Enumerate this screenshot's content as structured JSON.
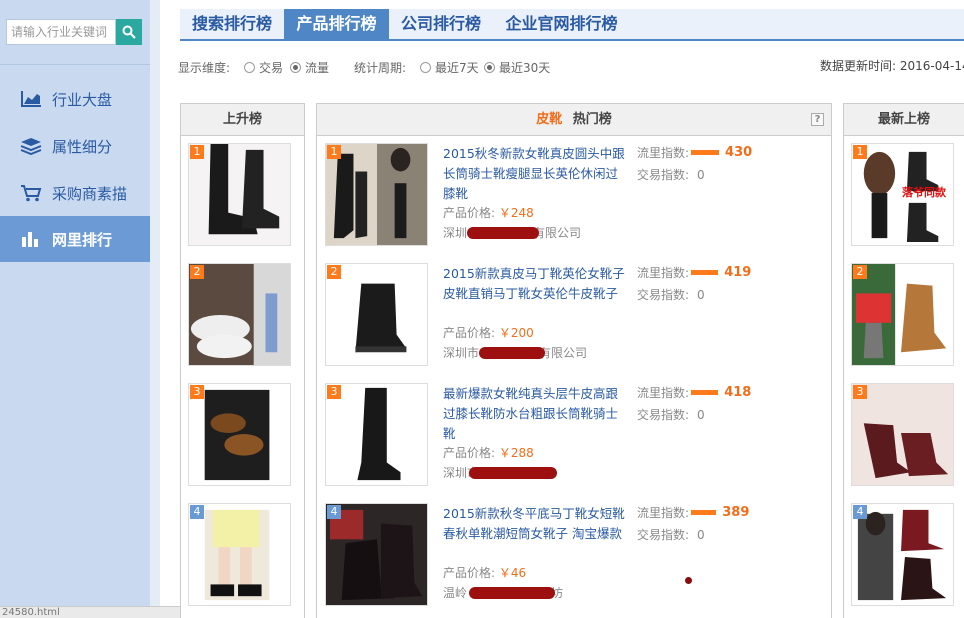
{
  "sidebar": {
    "search_placeholder": "请输入行业关键词",
    "items": [
      {
        "label": "行业大盘",
        "icon": "area-chart-icon"
      },
      {
        "label": "属性细分",
        "icon": "layers-icon"
      },
      {
        "label": "采购商素描",
        "icon": "cart-icon"
      },
      {
        "label": "网里排行",
        "icon": "bar-chart-icon",
        "active": true
      }
    ]
  },
  "status_bar": "24580.html",
  "tabs": [
    {
      "label": "搜索排行榜",
      "active": false
    },
    {
      "label": "产品排行榜",
      "active": true
    },
    {
      "label": "公司排行榜",
      "active": false
    },
    {
      "label": "企业官网排行榜",
      "active": false
    }
  ],
  "filters": {
    "dimension_label": "显示维度:",
    "dimension_options": [
      {
        "label": "交易",
        "checked": false
      },
      {
        "label": "流量",
        "checked": true
      }
    ],
    "period_label": "统计周期:",
    "period_options": [
      {
        "label": "最近7天",
        "checked": false
      },
      {
        "label": "最近30天",
        "checked": true
      }
    ],
    "update_text": "数据更新时间: 2016-04-14"
  },
  "rising": {
    "title": "上升榜",
    "ranks": [
      "1",
      "2",
      "3",
      "4"
    ]
  },
  "hot": {
    "category": "皮靴",
    "title": "热门榜",
    "help": "?",
    "flow_label": "流里指数:",
    "trade_label": "交易指数:",
    "price_label": "产品价格:",
    "products": [
      {
        "rank": "1",
        "title": "2015秋冬新款女靴真皮圆头中跟长筒骑士靴瘦腿显长英伦休闲过膝靴",
        "price": "￥248",
        "shop_prefix": "深圳",
        "shop_suffix": "有限公司",
        "flow": "430",
        "trade": "0",
        "bar_pct": 100
      },
      {
        "rank": "2",
        "title": "2015新款真皮马丁靴英伦女靴子皮靴直销马丁靴女英伦牛皮靴子",
        "price": "￥200",
        "shop_prefix": "深圳市",
        "shop_suffix": "有限公司",
        "flow": "419",
        "trade": "0",
        "bar_pct": 97
      },
      {
        "rank": "3",
        "title": "最新爆款女靴纯真头层牛皮高跟过膝长靴防水台粗跟长筒靴骑士靴",
        "price": "￥288",
        "shop_prefix": "深圳市",
        "shop_suffix": "",
        "flow": "418",
        "trade": "0",
        "bar_pct": 97
      },
      {
        "rank": "4",
        "title": "2015新款秋冬平底马丁靴女短靴春秋单靴潮短筒女靴子 淘宝爆款",
        "price": "￥46",
        "shop_prefix": "温岭",
        "shop_suffix": "坊",
        "flow": "389",
        "trade": "0",
        "bar_pct": 90
      }
    ]
  },
  "newest": {
    "title": "最新上榜",
    "ranks": [
      "1",
      "2",
      "3",
      "4"
    ],
    "overlay_text": "落爷同款"
  },
  "colors": {
    "accent": "#4f86c6",
    "orange": "#ff7a1a",
    "sidebar": "#c9daf0"
  }
}
